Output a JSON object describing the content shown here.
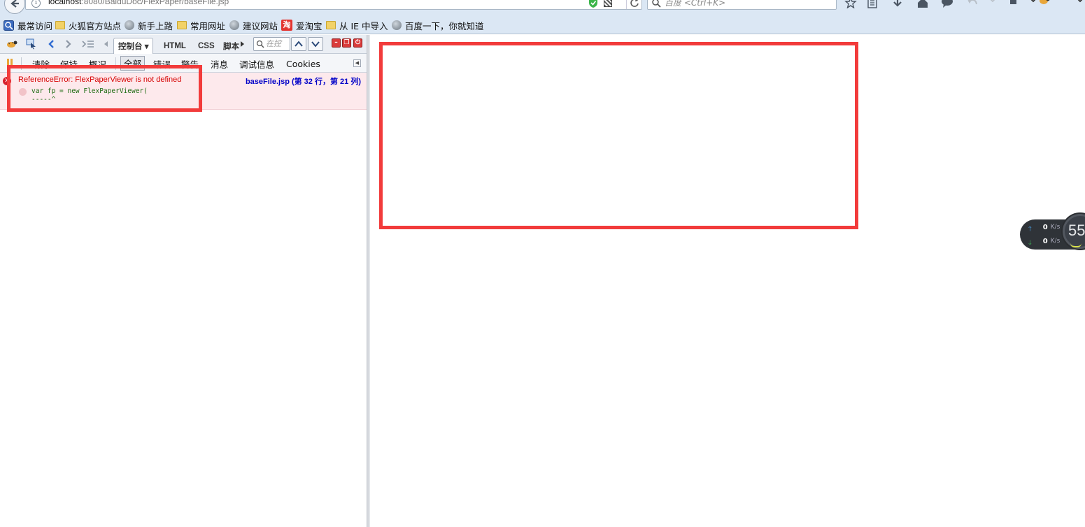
{
  "browser": {
    "url_host": "localhost",
    "url_path": ":8080/BaiduDoc/FlexPaper/baseFile.jsp",
    "search_placeholder": "百度 <Ctrl+K>"
  },
  "bookmarks": [
    {
      "label": "最常访问",
      "icon": "most-visited-icon"
    },
    {
      "label": "火狐官方站点",
      "icon": "folder-icon"
    },
    {
      "label": "新手上路",
      "icon": "globe-icon"
    },
    {
      "label": "常用网址",
      "icon": "folder-icon"
    },
    {
      "label": "建议网站",
      "icon": "globe-icon"
    },
    {
      "label": "爱淘宝",
      "icon": "taobao-icon"
    },
    {
      "label": "从 IE 中导入",
      "icon": "folder-icon"
    },
    {
      "label": "百度一下，你就知道",
      "icon": "globe-icon"
    }
  ],
  "firebug": {
    "tabs": [
      "控制台 ▾",
      "HTML",
      "CSS",
      "脚本"
    ],
    "search_placeholder": "在控",
    "console_buttons": [
      "清除",
      "保持",
      "概况"
    ],
    "filters": [
      "全部",
      "错误",
      "警告",
      "消息",
      "调试信息",
      "Cookies"
    ],
    "error": {
      "message": "ReferenceError: FlexPaperViewer is not defined",
      "source": "baseFile.jsp (第 32 行，第 21 列)",
      "code": "var fp = new FlexPaperViewer(",
      "caret": "-----^"
    }
  },
  "speed_widget": {
    "up_value": "0",
    "up_unit": "K/s",
    "down_value": "0",
    "down_unit": "K/s",
    "percent": "55"
  },
  "colors": {
    "highlight": "#f23b3b",
    "error_text": "#d60000",
    "source_link": "#0000c8",
    "toolbar_bg": "#dbe7f4"
  }
}
